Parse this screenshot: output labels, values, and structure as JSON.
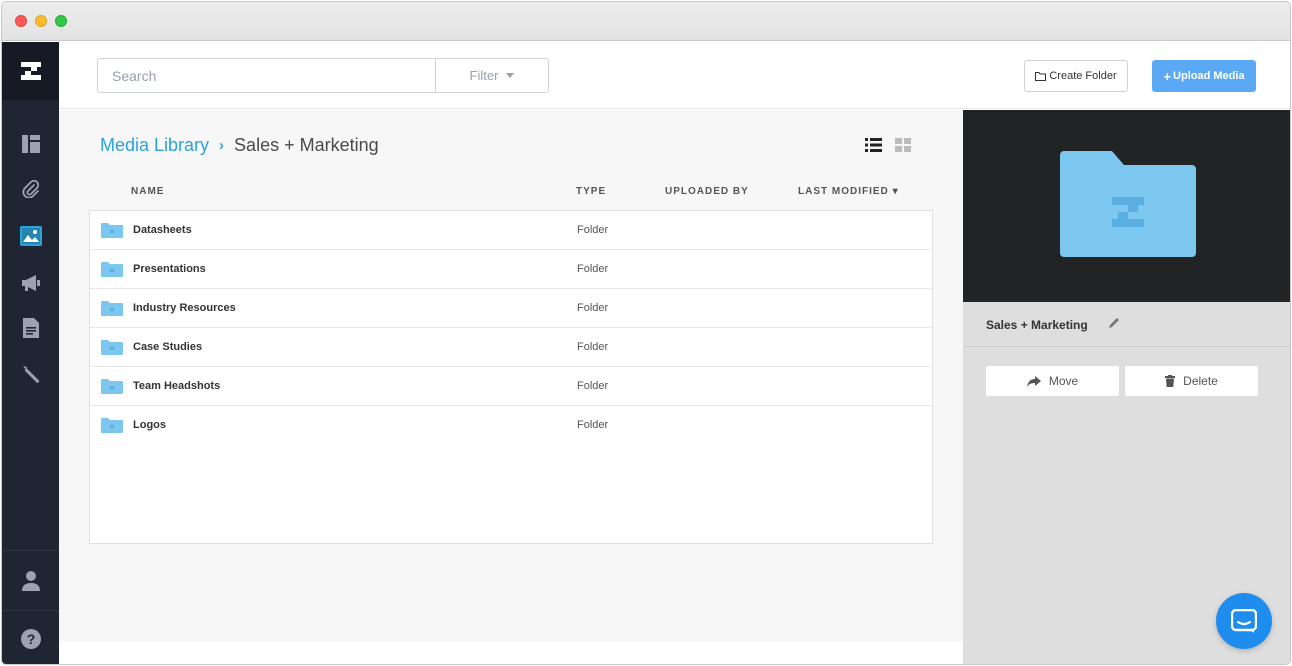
{
  "topbar": {
    "search_placeholder": "Search",
    "filter_label": "Filter",
    "create_folder_label": "Create Folder",
    "upload_media_label": "Upload Media"
  },
  "breadcrumb": {
    "root": "Media Library",
    "separator": "›",
    "current": "Sales + Marketing"
  },
  "table": {
    "headers": {
      "name": "NAME",
      "type": "TYPE",
      "uploaded_by": "UPLOADED BY",
      "last_modified": "LAST MODIFIED"
    },
    "sort_indicator": "▾",
    "rows": [
      {
        "name": "Datasheets",
        "type": "Folder"
      },
      {
        "name": "Presentations",
        "type": "Folder"
      },
      {
        "name": "Industry Resources",
        "type": "Folder"
      },
      {
        "name": "Case Studies",
        "type": "Folder"
      },
      {
        "name": "Team Headshots",
        "type": "Folder"
      },
      {
        "name": "Logos",
        "type": "Folder"
      }
    ]
  },
  "panel": {
    "title": "Sales + Marketing",
    "move_label": "Move",
    "delete_label": "Delete"
  },
  "icons": {
    "sidebar": [
      "logo-icon",
      "dashboard-icon",
      "paperclip-icon",
      "image-icon",
      "megaphone-icon",
      "document-icon",
      "tools-icon",
      "user-icon",
      "help-icon"
    ],
    "folder": "folder-icon",
    "chat": "chat-icon"
  },
  "colors": {
    "accent": "#2aa4d8",
    "primary_button": "#5ba9f4",
    "sidebar": "#1f2532",
    "folder": "#7cc7f0",
    "chat": "#1f8ded"
  }
}
